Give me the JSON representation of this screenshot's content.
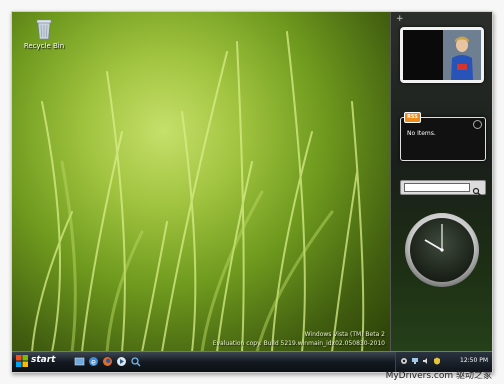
{
  "desktop": {
    "recycle_bin_label": "Recycle Bin",
    "watermark_line1": "Windows Vista (TM) Beta 2",
    "watermark_line2": "Evaluation copy. Build 5219.winmain_idx02.050830-2010"
  },
  "sidebar": {
    "add_label": "+",
    "feed_badge": "RSS",
    "feed_empty_text": "No Items.",
    "search_placeholder": "",
    "clock_time": "12:50"
  },
  "taskbar": {
    "start_label": "start",
    "quick_launch": [
      "windows-icon",
      "ie-icon",
      "firefox-icon",
      "media-icon",
      "search-icon"
    ],
    "tray_icons": [
      "gear-icon",
      "network-icon",
      "volume-icon",
      "shield-icon"
    ],
    "clock": "12:50 PM"
  },
  "page": {
    "site_watermark": "MyDrivers.com 驱动之家"
  },
  "colors": {
    "wallpaper_green": "#9fc23e",
    "rss_orange": "#f08a18",
    "taskbar_dark": "#141a22"
  }
}
